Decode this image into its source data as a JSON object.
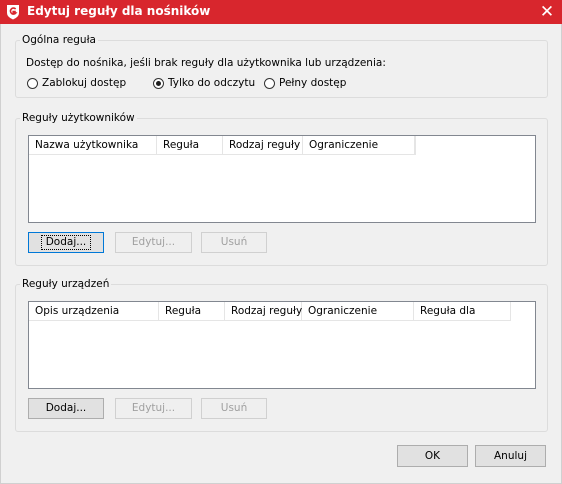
{
  "window": {
    "title": "Edytuj reguły dla nośników",
    "close_icon": "close-icon"
  },
  "general": {
    "legend": "Ogólna reguła",
    "prompt": "Dostęp do nośnika, jeśli brak reguły dla użytkownika lub urządzenia:",
    "options": [
      {
        "label": "Zablokuj dostęp",
        "checked": false
      },
      {
        "label": "Tylko do odczytu",
        "checked": true
      },
      {
        "label": "Pełny dostęp",
        "checked": false
      }
    ]
  },
  "user_rules": {
    "legend": "Reguły użytkowników",
    "columns": [
      "Nazwa użytkownika",
      "Reguła",
      "Rodzaj reguły",
      "Ograniczenie"
    ],
    "rows": [],
    "add_label": "Dodaj...",
    "edit_label": "Edytuj...",
    "delete_label": "Usuń"
  },
  "device_rules": {
    "legend": "Reguły urządzeń",
    "columns": [
      "Opis urządzenia",
      "Reguła",
      "Rodzaj reguły",
      "Ograniczenie",
      "Reguła dla"
    ],
    "rows": [],
    "add_label": "Dodaj...",
    "edit_label": "Edytuj...",
    "delete_label": "Usuń"
  },
  "footer": {
    "ok_label": "OK",
    "cancel_label": "Anuluj"
  },
  "colors": {
    "titlebar": "#d8262d",
    "focus_border": "#0078d7"
  }
}
